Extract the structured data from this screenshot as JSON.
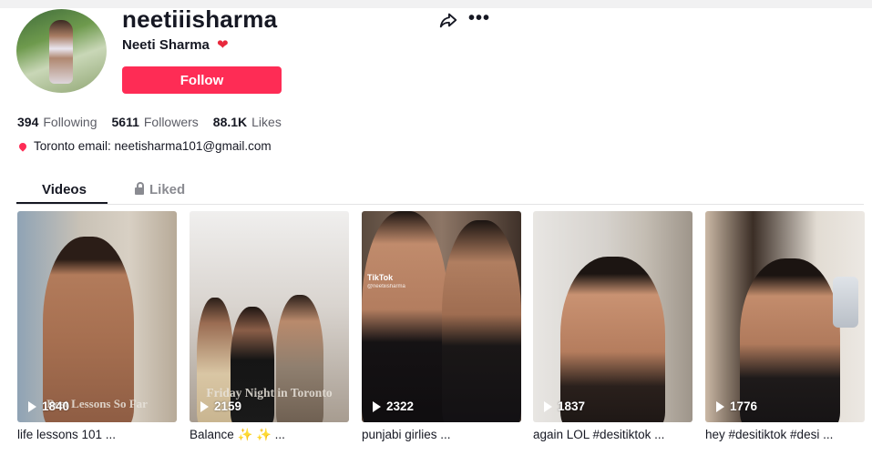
{
  "profile": {
    "username": "neetiiisharma",
    "display_name": "Neeti Sharma",
    "heart_emoji": "❤",
    "follow_label": "Follow",
    "share_icon": "share-arrow-icon",
    "more_icon": "more-dots-icon",
    "more_glyph": "•••",
    "avatar_icon": "avatar"
  },
  "stats": {
    "following_count": "394",
    "following_label": "Following",
    "followers_count": "5611",
    "followers_label": "Followers",
    "likes_count": "88.1K",
    "likes_label": "Likes"
  },
  "bio": {
    "text": "Toronto email: neetisharma101@gmail.com"
  },
  "tabs": {
    "videos": "Videos",
    "liked": "Liked"
  },
  "videos": [
    {
      "views": "1840",
      "caption": "life lessons 101 ...",
      "overlay": "Best Lessons So Far"
    },
    {
      "views": "2159",
      "caption": "Balance ✨ ✨ ...",
      "overlay": "Friday Night in Toronto"
    },
    {
      "views": "2322",
      "caption": "punjabi girlies ...",
      "watermark": "TikTok",
      "watermark_handle": "@neetiiisharma"
    },
    {
      "views": "1837",
      "caption": "again LOL #desitiktok ..."
    },
    {
      "views": "1776",
      "caption": "hey #desitiktok #desi ..."
    }
  ],
  "colors": {
    "accent": "#fe2c55",
    "text": "#161823",
    "muted": "#5c5d66"
  }
}
